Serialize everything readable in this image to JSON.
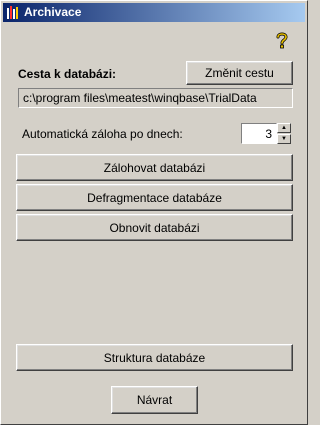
{
  "window": {
    "title": "Archivace"
  },
  "path": {
    "label": "Cesta k databázi:",
    "change_button": "Změnit cestu",
    "value": "c:\\program files\\meatest\\winqbase\\TrialData"
  },
  "backup": {
    "label": "Automatická záloha po dnech:",
    "days": "3"
  },
  "actions": {
    "backup_button": "Zálohovat databázi",
    "defrag_button": "Defragmentace databáze",
    "restore_button": "Obnovit databázi",
    "structure_button": "Struktura databáze",
    "return_button": "Návrat"
  },
  "icons": {
    "app": "archive-app-icon",
    "help": "help-question-icon",
    "spin_up": "spin-up-arrow-icon",
    "spin_down": "spin-down-arrow-icon"
  },
  "colors": {
    "window_bg": "#d4d0c8",
    "title_start": "#0a246a",
    "title_end": "#a6caf0",
    "help_icon": "#e8c000"
  }
}
